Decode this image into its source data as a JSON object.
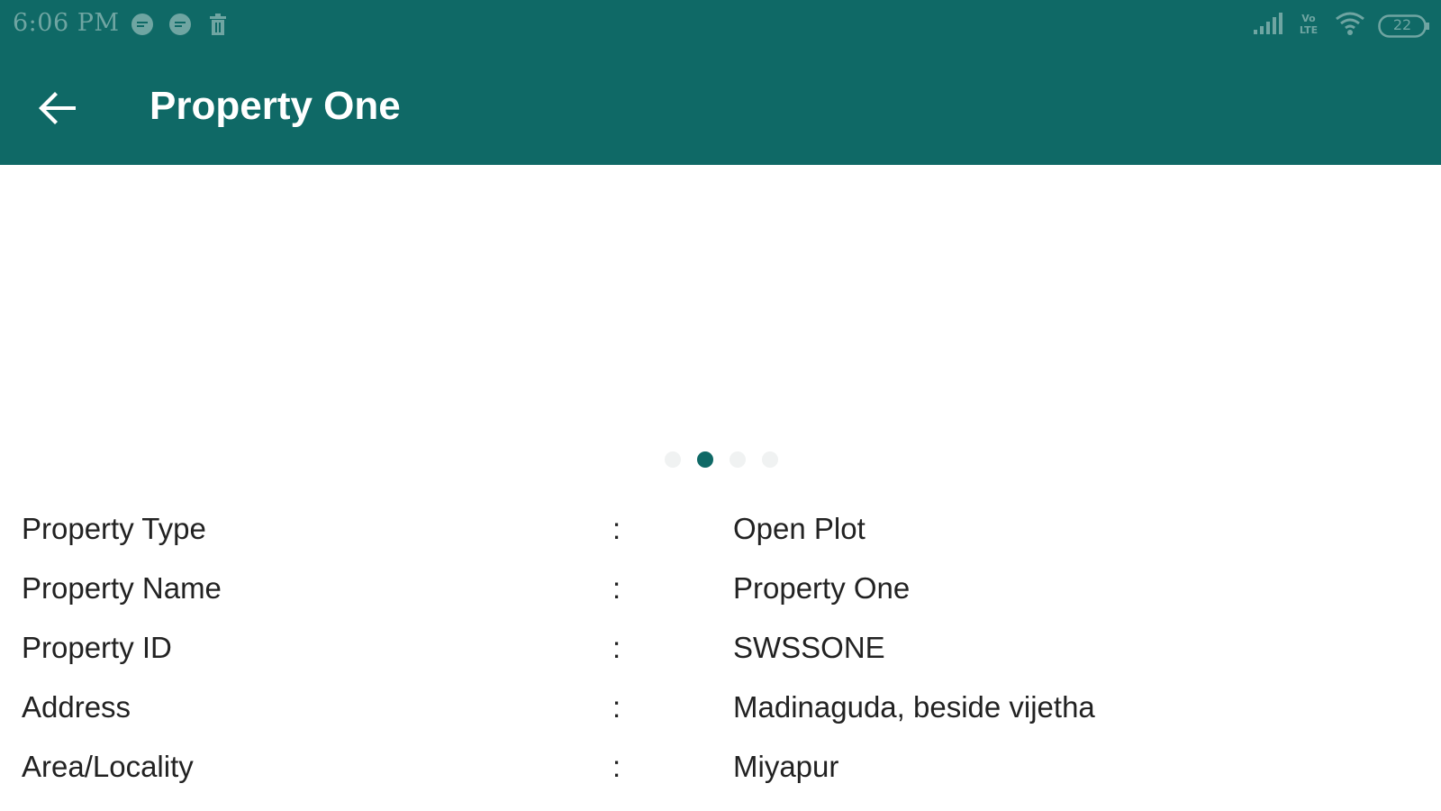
{
  "status_bar": {
    "time": "6:06 PM",
    "notification_icons": [
      "chat-bubble-icon",
      "chat-bubble-icon",
      "trash-icon"
    ],
    "network_label": "Vo LTE",
    "battery": "22"
  },
  "app_bar": {
    "back_icon": "arrow-back-icon",
    "title": "Property One",
    "color": "#0f6966"
  },
  "gallery": {
    "page_count": 4,
    "active_index": 1
  },
  "details": [
    {
      "label": "Property Type",
      "separator": ":",
      "value": "Open Plot"
    },
    {
      "label": "Property Name",
      "separator": ":",
      "value": "Property One"
    },
    {
      "label": "Property ID",
      "separator": ":",
      "value": "SWSSONE"
    },
    {
      "label": "Address",
      "separator": ":",
      "value": "Madinaguda, beside vijetha"
    },
    {
      "label": "Area/Locality",
      "separator": ":",
      "value": "Miyapur"
    }
  ]
}
